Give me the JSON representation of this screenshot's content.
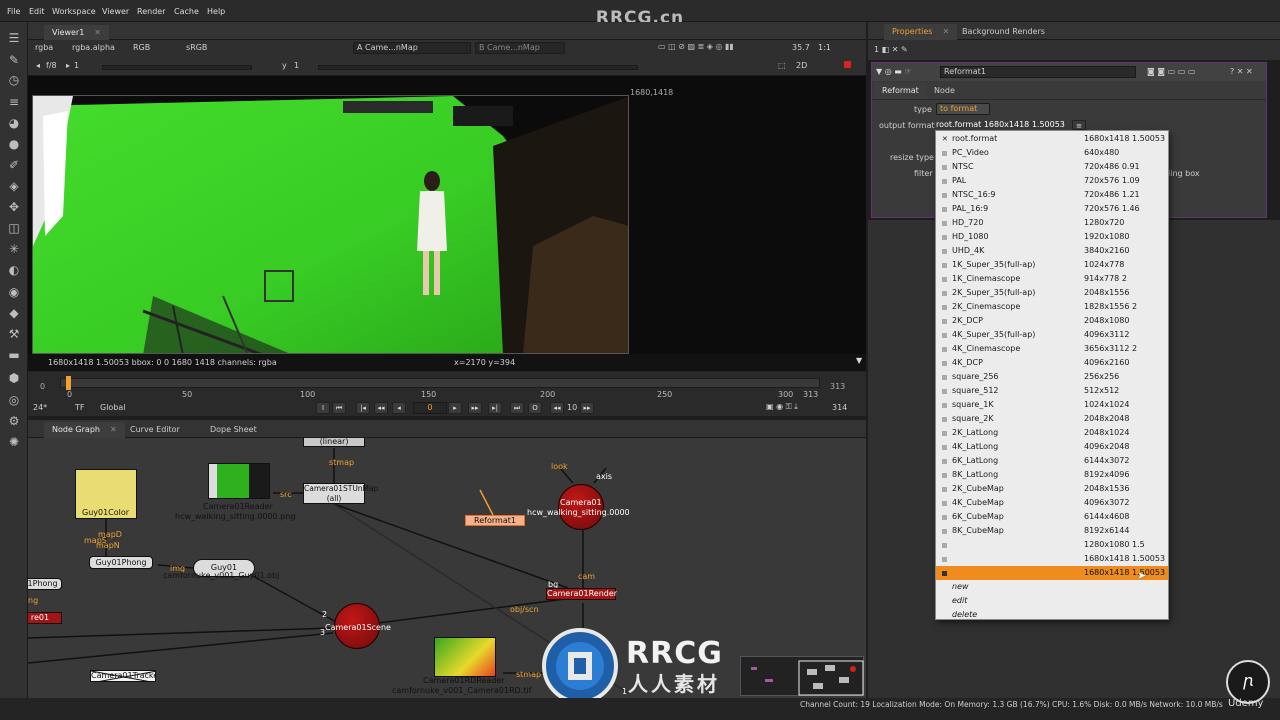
{
  "watermark": "RRCG.cn",
  "menu": [
    "File",
    "Edit",
    "Workspace",
    "Viewer",
    "Render",
    "Cache",
    "Help"
  ],
  "viewer": {
    "tab": "Viewer1",
    "channels": "rgba",
    "alpha": "rgba.alpha",
    "colorspace_in": "RGB",
    "colorspace_out": "sRGB",
    "input_a": "A  Came...nMap",
    "input_b": "B  Came...nMap",
    "zoom": "35.7",
    "ratio": "1:1",
    "fstop": "f/8",
    "exposure": "1",
    "y_label": "y",
    "gamma": "1",
    "mode": "2D",
    "format_corner": "1680,1418",
    "info_left": "1680x1418 1.50053   bbox: 0 0 1680 1418 channels: rgba",
    "info_coords": "x=2170 y=394"
  },
  "timeline": {
    "ticks": [
      "0",
      "50",
      "100",
      "150",
      "200",
      "250",
      "300",
      "313"
    ],
    "start": "0",
    "end_top": "313",
    "end_bottom": "314",
    "fps": "24*",
    "tf": "TF",
    "global": "Global",
    "current_frame": "0",
    "step": "10"
  },
  "tabs": {
    "node_graph": "Node Graph",
    "curve_editor": "Curve Editor",
    "dope_sheet": "Dope Sheet",
    "properties": "Properties",
    "background_renders": "Background Renders"
  },
  "nodes": {
    "linear": "(linear)",
    "stmap_top": "stmap",
    "src": "src",
    "stunmap": "Camera01STUnMap",
    "stunmap_sub": "(all)",
    "guy_color": "Guy01Color",
    "reader": "Camera01Reader",
    "reader_file": "hcw_walking_sitting.0000.png",
    "reformat": "Reformat1",
    "look": "look",
    "axis": "axis",
    "camera": "Camera01",
    "camera_file": "hcw_walking_sitting.0000",
    "mapd": "mapD",
    "maps": "mapS",
    "mapn": "mapN",
    "phong": "Guy01Phong",
    "phong_left": "01Phong",
    "img": "img",
    "guy": "Guy01",
    "guy_file": "camfornuke_v001_Guy01.obj",
    "ng": "ng",
    "re": "re01",
    "scene": "Camera01Scene",
    "in2": "2",
    "in3": "3",
    "objscn": "obj/scn",
    "bg": "bg",
    "cam": "cam",
    "render": "Camera01Render",
    "trackers": "Camera01Trackers",
    "rd_reader": "Camera01RDReader",
    "rd_file": "camfornuke_v001_Camera01RD.tif",
    "stmap_bottom": "stmap",
    "one": "1"
  },
  "properties": {
    "node_name": "Reformat1",
    "tab_reformat": "Reformat",
    "tab_node": "Node",
    "type_label": "type",
    "type_value": "to format",
    "output_label": "output format",
    "output_value": "root.format 1680x1418 1.50053",
    "resize_label": "resize type",
    "filter_label": "filter",
    "bbox_fragment": "ling box"
  },
  "dropdown": [
    {
      "name": "root.format",
      "dim": "1680x1418 1.50053",
      "checked": true
    },
    {
      "name": "PC_Video",
      "dim": "640x480"
    },
    {
      "name": "NTSC",
      "dim": "720x486 0.91"
    },
    {
      "name": "PAL",
      "dim": "720x576 1.09"
    },
    {
      "name": "NTSC_16:9",
      "dim": "720x486 1.21"
    },
    {
      "name": "PAL_16:9",
      "dim": "720x576 1.46"
    },
    {
      "name": "HD_720",
      "dim": "1280x720"
    },
    {
      "name": "HD_1080",
      "dim": "1920x1080"
    },
    {
      "name": "UHD_4K",
      "dim": "3840x2160"
    },
    {
      "name": "1K_Super_35(full-ap)",
      "dim": "1024x778"
    },
    {
      "name": "1K_Cinemascope",
      "dim": "914x778 2"
    },
    {
      "name": "2K_Super_35(full-ap)",
      "dim": "2048x1556"
    },
    {
      "name": "2K_Cinemascope",
      "dim": "1828x1556 2"
    },
    {
      "name": "2K_DCP",
      "dim": "2048x1080"
    },
    {
      "name": "4K_Super_35(full-ap)",
      "dim": "4096x3112"
    },
    {
      "name": "4K_Cinemascope",
      "dim": "3656x3112 2"
    },
    {
      "name": "4K_DCP",
      "dim": "4096x2160"
    },
    {
      "name": "square_256",
      "dim": "256x256"
    },
    {
      "name": "square_512",
      "dim": "512x512"
    },
    {
      "name": "square_1K",
      "dim": "1024x1024"
    },
    {
      "name": "square_2K",
      "dim": "2048x2048"
    },
    {
      "name": "2K_LatLong",
      "dim": "2048x1024"
    },
    {
      "name": "4K_LatLong",
      "dim": "4096x2048"
    },
    {
      "name": "6K_LatLong",
      "dim": "6144x3072"
    },
    {
      "name": "8K_LatLong",
      "dim": "8192x4096"
    },
    {
      "name": "2K_CubeMap",
      "dim": "2048x1536"
    },
    {
      "name": "4K_CubeMap",
      "dim": "4096x3072"
    },
    {
      "name": "6K_CubeMap",
      "dim": "6144x4608"
    },
    {
      "name": "8K_CubeMap",
      "dim": "8192x6144"
    },
    {
      "name": "",
      "dim": "1280x1080 1.5"
    },
    {
      "name": "",
      "dim": "1680x1418 1.50053"
    },
    {
      "name": "",
      "dim": "1680x1418 1.50053",
      "highlight": true
    },
    {
      "name": "new",
      "dim": "",
      "italic": true
    },
    {
      "name": "edit",
      "dim": "",
      "italic": true
    },
    {
      "name": "delete",
      "dim": "",
      "italic": true
    }
  ],
  "status": "Channel Count: 19  Localization Mode: On  Memory: 1.3 GB (16.7%)  CPU: 1.6%  Disk: 0.0 MB/s  Network: 10.0 MB/s",
  "logo": {
    "text": "RRCG",
    "cn": "人人素材"
  },
  "udemy": "Udemy",
  "colors": {
    "highlight": "#f08c1e",
    "accent": "#f0a030",
    "green_screen": "#3fd12a",
    "node_red": "#b01414"
  }
}
